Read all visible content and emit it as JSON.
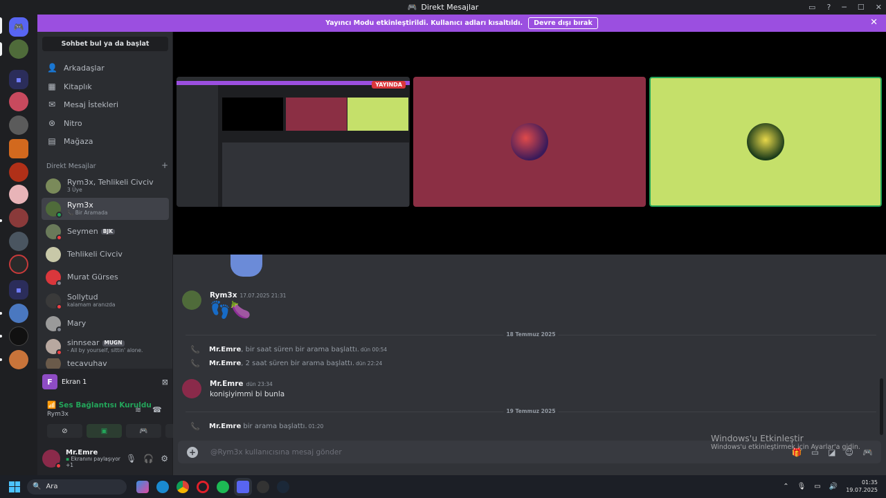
{
  "window": {
    "title": "Direkt Mesajlar",
    "app_icon": "discord-icon"
  },
  "banner": {
    "text": "Yayıncı Modu etkinleştirildi. Kullanıcı adları kısaltıldı.",
    "button": "Devre dışı bırak",
    "bg": "#9b4fe0"
  },
  "sidebar": {
    "search_button": "Sohbet bul ya da başlat",
    "nav": [
      {
        "label": "Arkadaşlar",
        "icon": "friends-icon"
      },
      {
        "label": "Kitaplık",
        "icon": "library-icon"
      },
      {
        "label": "Mesaj İstekleri",
        "icon": "mail-icon"
      },
      {
        "label": "Nitro",
        "icon": "nitro-icon"
      },
      {
        "label": "Mağaza",
        "icon": "store-icon"
      }
    ],
    "dm_header": "Direkt Mesajlar",
    "dms": [
      {
        "name": "Rym3x, Tehlikeli Civciv",
        "sub": "3 Üye",
        "tag": ""
      },
      {
        "name": "Rym3x",
        "sub": "Bir Aramada",
        "tag": ""
      },
      {
        "name": "Seymen",
        "sub": "",
        "tag": "BJK"
      },
      {
        "name": "Tehlikeli Civciv",
        "sub": "",
        "tag": ""
      },
      {
        "name": "Murat Gürses",
        "sub": "",
        "tag": ""
      },
      {
        "name": "Sollytud",
        "sub": "kalamam aranızda",
        "tag": ""
      },
      {
        "name": "Mary",
        "sub": "",
        "tag": ""
      },
      {
        "name": "sinnsear",
        "sub": "- All by yourself, sittin' alone.",
        "tag": "MUGN"
      },
      {
        "name": "tecavuhav",
        "sub": "",
        "tag": ""
      }
    ]
  },
  "panel": {
    "screen_label": "Ekran 1",
    "screen_letter": "F",
    "voice_status": "Ses Bağlantısı Kuruldu",
    "voice_channel": "Rym3x",
    "user_name": "Mr.Emre",
    "user_sub": "Ekranını paylaşıyor +1"
  },
  "stage": {
    "live_badge": "YAYINDA"
  },
  "chat": {
    "messages": [
      {
        "author": "Rym3x",
        "time": "17.07.2025 21:31",
        "text": "👣🍆"
      },
      {
        "author": "Mr.Emre",
        "time": "dün 23:34",
        "text": "konişiyimmi bi bunla"
      }
    ],
    "date_dividers": [
      "18 Temmuz 2025",
      "19 Temmuz 2025"
    ],
    "system": [
      {
        "author": "Mr.Emre",
        "text": ", bir saat süren bir arama başlattı.",
        "time": "dün 00:54"
      },
      {
        "author": "Mr.Emre",
        "text": ", 2 saat süren bir arama başlattı.",
        "time": "dün 22:24"
      },
      {
        "author": "Mr.Emre",
        "text": " bir arama başlattı.",
        "time": "01:20"
      }
    ],
    "input_placeholder": "@Rym3x kullanıcısına mesaj gönder"
  },
  "watermark": {
    "line1": "Windows'u Etkinleştir",
    "line2": "Windows'u etkinleştirmek için Ayarlar'a gidin."
  },
  "taskbar": {
    "search": "Ara",
    "time": "01:35",
    "date": "19.07.2025"
  }
}
